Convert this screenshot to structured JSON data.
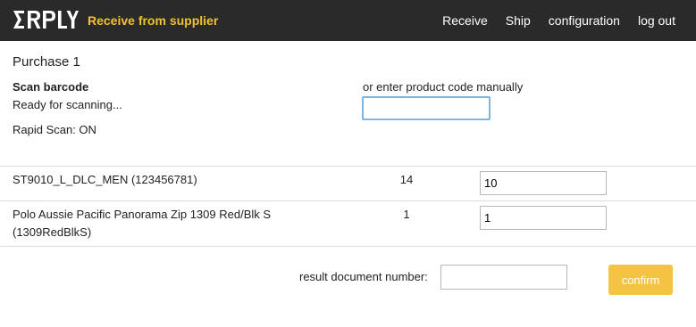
{
  "header": {
    "logo_text": "ERPLY",
    "app_title": "Receive from supplier",
    "nav": [
      "Receive",
      "Ship",
      "configuration",
      "log out"
    ]
  },
  "purchase_title": "Purchase 1",
  "scan": {
    "label": "Scan barcode",
    "status": "Ready for scanning...",
    "rapid": "Rapid Scan: ON"
  },
  "manual": {
    "label": "or enter product code manually",
    "value": ""
  },
  "items": [
    {
      "name": "ST9010_L_DLC_MEN (123456781)",
      "qty": "14",
      "received": "10"
    },
    {
      "name": "Polo Aussie Pacific Panorama Zip 1309 Red/Blk S (1309RedBlkS)",
      "qty": "1",
      "received": "1"
    }
  ],
  "result": {
    "label": "result document number:",
    "value": ""
  },
  "confirm_label": "confirm",
  "colors": {
    "header_bg": "#2a2a2a",
    "accent": "#f2c232",
    "button": "#f4c342",
    "focus": "#7fb2e6"
  }
}
